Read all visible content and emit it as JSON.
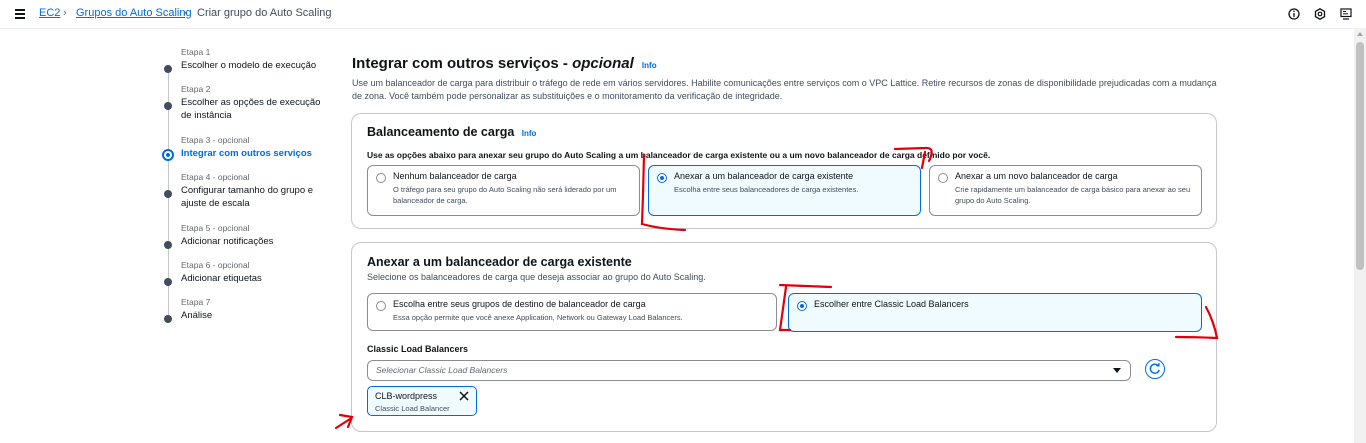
{
  "breadcrumb": {
    "items": [
      "EC2",
      "Grupos do Auto Scaling"
    ],
    "current": "Criar grupo do Auto Scaling"
  },
  "steps": [
    {
      "num": "Etapa 1",
      "name": "Escolher o modelo de execução"
    },
    {
      "num": "Etapa 2",
      "name": "Escolher as opções de execução de instância"
    },
    {
      "num": "Etapa 3 - opcional",
      "name": "Integrar com outros serviços",
      "active": true
    },
    {
      "num": "Etapa 4 - opcional",
      "name": "Configurar tamanho do grupo e ajuste de escala"
    },
    {
      "num": "Etapa 5 - opcional",
      "name": "Adicionar notificações"
    },
    {
      "num": "Etapa 6 - opcional",
      "name": "Adicionar etiquetas"
    },
    {
      "num": "Etapa 7",
      "name": "Análise"
    }
  ],
  "page": {
    "title": "Integrar com outros serviços -",
    "title_optional": "opcional",
    "info": "Info",
    "description": "Use um balanceador de carga para distribuir o tráfego de rede em vários servidores. Habilite comunicações entre serviços com o VPC Lattice. Retire recursos de zonas de disponibilidade prejudicadas com a mudança de zona. Você também pode personalizar as substituições e o monitoramento da verificação de integridade."
  },
  "lb_panel": {
    "title": "Balanceamento de carga",
    "info": "Info",
    "instruction": "Use as opções abaixo para anexar seu grupo do Auto Scaling a um balanceador de carga existente ou a um novo balanceador de carga definido por você.",
    "options": [
      {
        "label": "Nenhum balanceador de carga",
        "desc": "O tráfego para seu grupo do Auto Scaling não será liderado por um balanceador de carga.",
        "selected": false
      },
      {
        "label": "Anexar a um balanceador de carga existente",
        "desc": "Escolha entre seus balanceadores de carga existentes.",
        "selected": true
      },
      {
        "label": "Anexar a um novo balanceador de carga",
        "desc": "Crie rapidamente um balanceador de carga básico para anexar ao seu grupo do Auto Scaling.",
        "selected": false
      }
    ]
  },
  "attach_panel": {
    "title": "Anexar a um balanceador de carga existente",
    "subtitle": "Selecione os balanceadores de carga que deseja associar ao grupo do Auto Scaling.",
    "options": [
      {
        "label": "Escolha entre seus grupos de destino de balanceador de carga",
        "desc": "Essa opção permite que você anexe Application, Network ou Gateway Load Balancers.",
        "selected": false
      },
      {
        "label": "Escolher entre Classic Load Balancers",
        "desc": "",
        "selected": true
      }
    ],
    "clb_label": "Classic Load Balancers",
    "clb_placeholder": "Selecionar Classic Load Balancers",
    "token": {
      "name": "CLB-wordpress",
      "desc": "Classic Load Balancer"
    }
  },
  "colors": {
    "accent": "#006ce0",
    "annotation": "#e0000a"
  }
}
